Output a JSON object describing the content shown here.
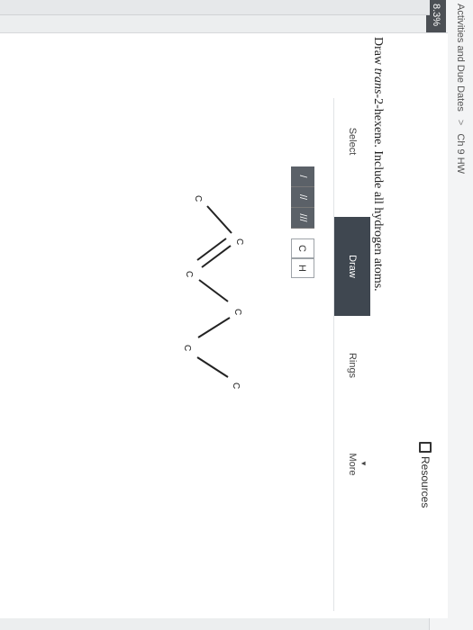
{
  "header": {
    "breadcrumb": [
      "Activities and Due Dates",
      "Ch 9 HW"
    ],
    "breadcrumb_separator": ">",
    "progress": "8.3%"
  },
  "question": {
    "prefix": "Draw ",
    "italic": "trans",
    "suffix": "-2-hexene. Include all hydrogen atoms."
  },
  "toolbar": {
    "select": "Select",
    "draw": "Draw",
    "rings": "Rings",
    "more": "More"
  },
  "bonds": [
    "/",
    "//",
    "///"
  ],
  "atoms": [
    "C",
    "H"
  ],
  "molecule": {
    "atom_label": "C"
  },
  "resources": {
    "label": "Resources"
  }
}
